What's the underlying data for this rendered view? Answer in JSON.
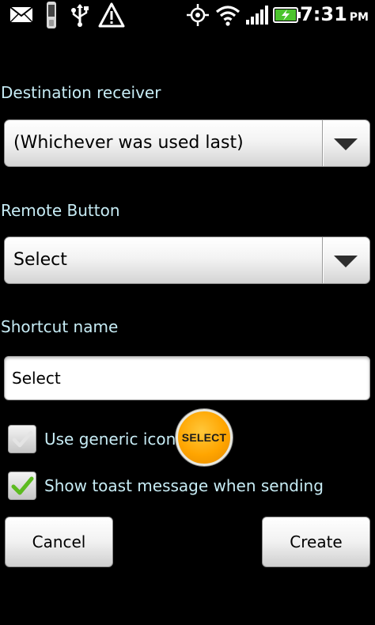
{
  "status_bar": {
    "time": "7:31",
    "ampm": "PM",
    "icons": [
      "mail-icon",
      "phone-icon",
      "usb-icon",
      "warning-icon",
      "gps-icon",
      "wifi-icon",
      "signal-icon",
      "battery-charging-icon"
    ]
  },
  "destination": {
    "label": "Destination receiver",
    "selected": "(Whichever was used last)"
  },
  "remote_button": {
    "label": "Remote Button",
    "selected": "Select"
  },
  "shortcut": {
    "label": "Shortcut name",
    "value": "Select"
  },
  "generic_icon": {
    "label": "Use generic icon",
    "checked": false,
    "icon_text": "SELECT"
  },
  "toast": {
    "label": "Show toast message when sending",
    "checked": true
  },
  "buttons": {
    "cancel": "Cancel",
    "create": "Create"
  },
  "colors": {
    "background": "#000000",
    "label_text": "#c7ecf5",
    "check_green": "#5dbb20",
    "select_icon_orange": "#ffa500"
  }
}
